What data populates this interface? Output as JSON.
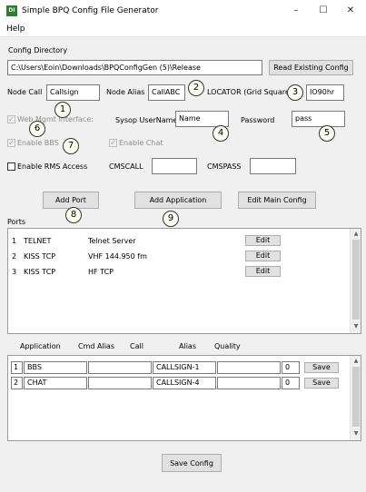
{
  "window": {
    "icon": "DI",
    "title": "Simple BPQ Config File Generator",
    "minimize": "–",
    "maximize": "☐",
    "close": "✕"
  },
  "menu": {
    "help": "Help"
  },
  "config_dir": {
    "label": "Config Directory",
    "value": "C:\\Users\\Eoin\\Downloads\\BPQConfigGen (5)\\Release",
    "read_button": "Read Existing Config"
  },
  "node": {
    "call_label": "Node Call",
    "call_value": "Callsign",
    "alias_label": "Node Alias",
    "alias_value": "CallABC",
    "locator_label": "LOCATOR (Grid Square)",
    "locator_value": "IO90hr"
  },
  "web": {
    "checkbox_label": "Web Mgmt Interface:",
    "sysop_label": "Sysop UserName",
    "sysop_value": "Name",
    "password_label": "Password",
    "password_value": "pass"
  },
  "features": {
    "bbs_label": "Enable BBS",
    "chat_label": "Enable Chat",
    "rms_label": "Enable RMS Access",
    "cmscall_label": "CMSCALL",
    "cmscall_value": "",
    "cmspass_label": "CMSPASS",
    "cmspass_value": ""
  },
  "checkmark": "✓",
  "actions": {
    "add_port": "Add Port",
    "add_application": "Add Application",
    "edit_main": "Edit Main Config"
  },
  "ports": {
    "label": "Ports",
    "edit_label": "Edit",
    "rows": [
      {
        "num": "1",
        "type": "TELNET",
        "desc": "Telnet Server"
      },
      {
        "num": "2",
        "type": "KISS TCP",
        "desc": "VHF 144.950 fm"
      },
      {
        "num": "3",
        "type": "KISS TCP",
        "desc": "HF TCP"
      }
    ]
  },
  "apps": {
    "headers": {
      "application": "Application",
      "cmd_alias": "Cmd Alias",
      "call": "Call",
      "alias": "Alias",
      "quality": "Quality"
    },
    "save_label": "Save",
    "rows": [
      {
        "num": "1",
        "application": "BBS",
        "cmd_alias": "",
        "call": "",
        "alias": "CALLSIGN-1",
        "quality": "",
        "q": "0"
      },
      {
        "num": "2",
        "application": "CHAT",
        "cmd_alias": "",
        "call": "",
        "alias": "CALLSIGN-4",
        "quality": "",
        "q": "0"
      }
    ]
  },
  "save_config": "Save Config",
  "scroll_arrows": {
    "up": "▲",
    "down": "▼"
  },
  "callouts": [
    "1",
    "2",
    "3",
    "4",
    "5",
    "6",
    "7",
    "8",
    "9"
  ]
}
